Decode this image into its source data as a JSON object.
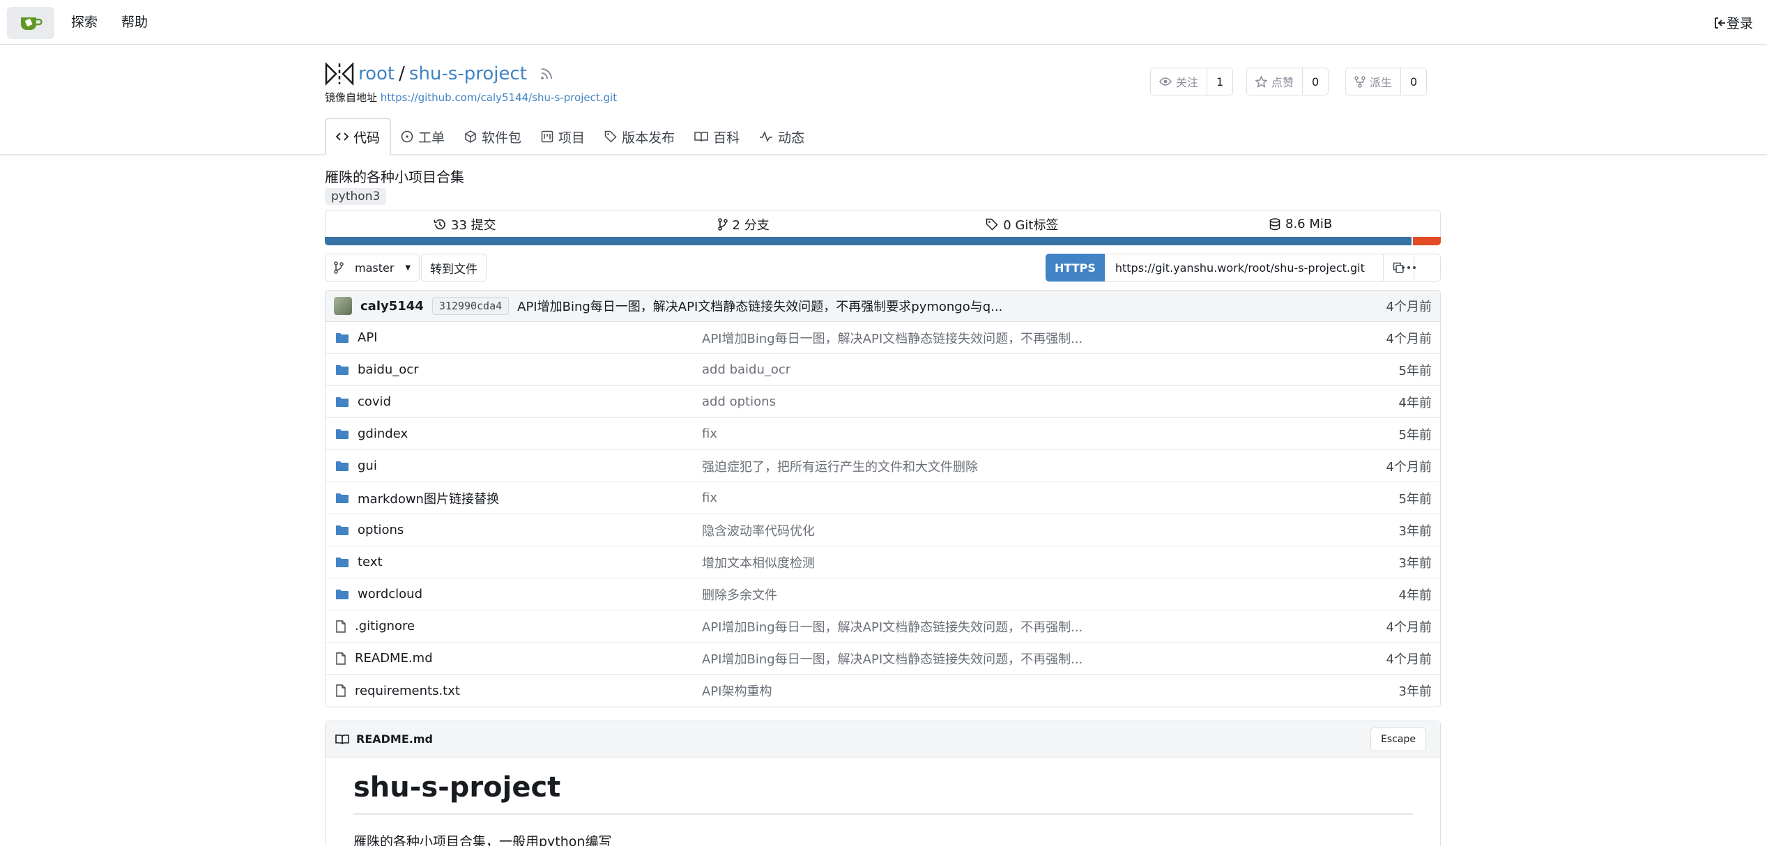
{
  "nav": {
    "explore": "探索",
    "help": "帮助",
    "login": "登录"
  },
  "repo": {
    "owner": "root",
    "separator": "/",
    "name": "shu-s-project",
    "mirror_label": "镜像自地址",
    "mirror_url": "https://github.com/caly5144/shu-s-project.git",
    "watch_label": "关注",
    "watch_count": "1",
    "star_label": "点赞",
    "star_count": "0",
    "fork_label": "派生",
    "fork_count": "0"
  },
  "tabs": [
    {
      "label": "代码",
      "icon": "code-icon"
    },
    {
      "label": "工单",
      "icon": "issue-icon"
    },
    {
      "label": "软件包",
      "icon": "package-icon"
    },
    {
      "label": "项目",
      "icon": "project-icon"
    },
    {
      "label": "版本发布",
      "icon": "tag-icon"
    },
    {
      "label": "百科",
      "icon": "book-icon"
    },
    {
      "label": "动态",
      "icon": "pulse-icon"
    }
  ],
  "description": "雁陎的各种小项目合集",
  "topic": "python3",
  "stats": {
    "commits": "33 提交",
    "branches": "2 分支",
    "tags": "0 Git标签",
    "size": "8.6 MiB"
  },
  "languages": [
    {
      "name": "Python",
      "percent": 97.4,
      "color": "#3572a5"
    },
    {
      "name": "Other",
      "percent": 2.6,
      "color": "#e34c26"
    }
  ],
  "toolbar": {
    "branch": "master",
    "goto_file": "转到文件",
    "clone_protocol": "HTTPS",
    "clone_url": "https://git.yanshu.work/root/shu-s-project.git"
  },
  "latest_commit": {
    "author": "caly5144",
    "sha": "312990cda4",
    "message": "API增加Bing每日一图，解决API文档静态链接失效问题，不再强制要求pymongo与q...",
    "age": "4个月前"
  },
  "files": [
    {
      "name": "API",
      "type": "dir",
      "message": "API增加Bing每日一图，解决API文档静态链接失效问题，不再强制...",
      "age": "4个月前"
    },
    {
      "name": "baidu_ocr",
      "type": "dir",
      "message": "add baidu_ocr",
      "age": "5年前"
    },
    {
      "name": "covid",
      "type": "dir",
      "message": "add options",
      "age": "4年前"
    },
    {
      "name": "gdindex",
      "type": "dir",
      "message": "fix",
      "age": "5年前"
    },
    {
      "name": "gui",
      "type": "dir",
      "message": "强迫症犯了，把所有运行产生的文件和大文件删除",
      "age": "4个月前"
    },
    {
      "name": "markdown图片链接替换",
      "type": "dir",
      "message": "fix",
      "age": "5年前"
    },
    {
      "name": "options",
      "type": "dir",
      "message": "隐含波动率代码优化",
      "age": "3年前"
    },
    {
      "name": "text",
      "type": "dir",
      "message": "增加文本相似度检测",
      "age": "3年前"
    },
    {
      "name": "wordcloud",
      "type": "dir",
      "message": "删除多余文件",
      "age": "4年前"
    },
    {
      "name": ".gitignore",
      "type": "file",
      "message": "API增加Bing每日一图，解决API文档静态链接失效问题，不再强制...",
      "age": "4个月前"
    },
    {
      "name": "README.md",
      "type": "file",
      "message": "API增加Bing每日一图，解决API文档静态链接失效问题，不再强制...",
      "age": "4个月前"
    },
    {
      "name": "requirements.txt",
      "type": "file",
      "message": "API架构重构",
      "age": "3年前"
    }
  ],
  "readme": {
    "filename": "README.md",
    "escape": "Escape",
    "title": "shu-s-project",
    "text": "雁陎的各种小项目合集，一般用python编写"
  }
}
